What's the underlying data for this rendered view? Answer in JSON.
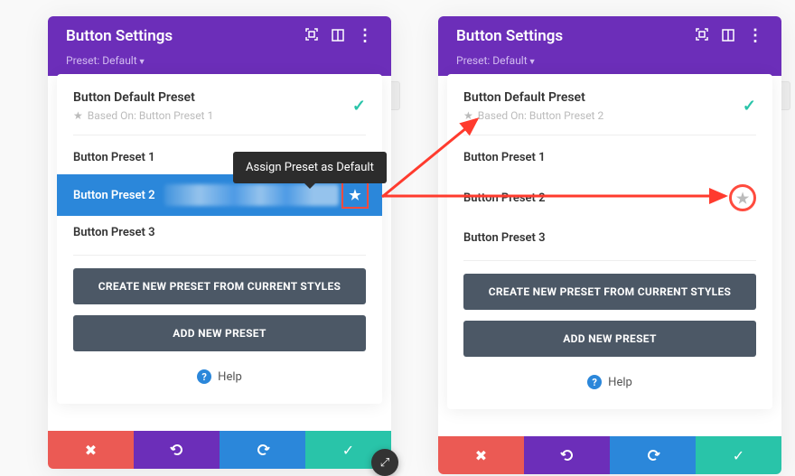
{
  "left": {
    "header": {
      "title": "Button Settings"
    },
    "preset_label": "Preset: Default",
    "default_preset": {
      "title": "Button Default Preset",
      "based_on": "Based On: Button Preset 1"
    },
    "presets": {
      "p1": "Button Preset 1",
      "p2": "Button Preset 2",
      "p3": "Button Preset 3"
    },
    "tooltip": "Assign Preset as Default",
    "buttons": {
      "create": "CREATE NEW PRESET FROM CURRENT STYLES",
      "add": "ADD NEW PRESET"
    },
    "help": "Help"
  },
  "right": {
    "header": {
      "title": "Button Settings"
    },
    "preset_label": "Preset: Default",
    "default_preset": {
      "title": "Button Default Preset",
      "based_on": "Based On: Button Preset 2"
    },
    "presets": {
      "p1": "Button Preset 1",
      "p2": "Button Preset 2",
      "p3": "Button Preset 3"
    },
    "buttons": {
      "create": "CREATE NEW PRESET FROM CURRENT STYLES",
      "add": "ADD NEW PRESET"
    },
    "help": "Help"
  },
  "colors": {
    "accent_purple": "#6c2eb9",
    "accent_blue": "#2b87da",
    "accent_green": "#29c4a9",
    "accent_red": "#eb5a54",
    "annotation_red": "#ff4b3e"
  }
}
